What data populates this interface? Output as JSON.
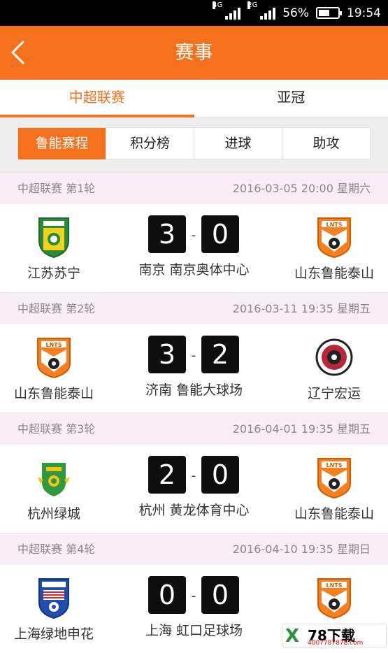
{
  "status_bar": {
    "net1": "4G",
    "net2": "2G",
    "battery": "56%",
    "battery_level": 0.56,
    "time": "19:54"
  },
  "header": {
    "title": "赛事",
    "back_icon": "chevron-left-icon"
  },
  "tabs": [
    {
      "label": "中超联赛",
      "active": true
    },
    {
      "label": "亚冠",
      "active": false
    }
  ],
  "subtabs": [
    {
      "label": "鲁能赛程",
      "active": true
    },
    {
      "label": "积分榜",
      "active": false
    },
    {
      "label": "进球",
      "active": false
    },
    {
      "label": "助攻",
      "active": false
    }
  ],
  "colors": {
    "accent": "#f6711c",
    "round_bg": "#f7eef5",
    "score_bg": "#0e0e0e"
  },
  "matches": [
    {
      "round": "中超联赛 第1轮",
      "datetime": "2016-03-05 20:00 星期六",
      "home": {
        "name": "江苏苏宁",
        "badge": "jiangsu-suning-badge"
      },
      "away": {
        "name": "山东鲁能泰山",
        "badge": "shandong-luneng-badge"
      },
      "home_score": "3",
      "away_score": "0",
      "venue": "南京 南京奥体中心"
    },
    {
      "round": "中超联赛 第2轮",
      "datetime": "2016-03-11 19:35 星期五",
      "home": {
        "name": "山东鲁能泰山",
        "badge": "shandong-luneng-badge"
      },
      "away": {
        "name": "辽宁宏运",
        "badge": "liaoning-hongyun-badge"
      },
      "home_score": "3",
      "away_score": "2",
      "venue": "济南 鲁能大球场"
    },
    {
      "round": "中超联赛 第3轮",
      "datetime": "2016-04-01 19:35 星期五",
      "home": {
        "name": "杭州绿城",
        "badge": "hangzhou-greentown-badge"
      },
      "away": {
        "name": "山东鲁能泰山",
        "badge": "shandong-luneng-badge"
      },
      "home_score": "2",
      "away_score": "0",
      "venue": "杭州 黄龙体育中心"
    },
    {
      "round": "中超联赛 第4轮",
      "datetime": "2016-04-10 19:35 星期日",
      "home": {
        "name": "上海绿地申花",
        "badge": "shanghai-shenhua-badge"
      },
      "away": {
        "name": "山东鲁能泰山",
        "badge": "shandong-luneng-badge"
      },
      "home_score": "0",
      "away_score": "0",
      "venue": "上海 虹口足球场"
    }
  ],
  "watermark": {
    "mark": "X",
    "text": "78下载",
    "url": "4007787878.com"
  }
}
